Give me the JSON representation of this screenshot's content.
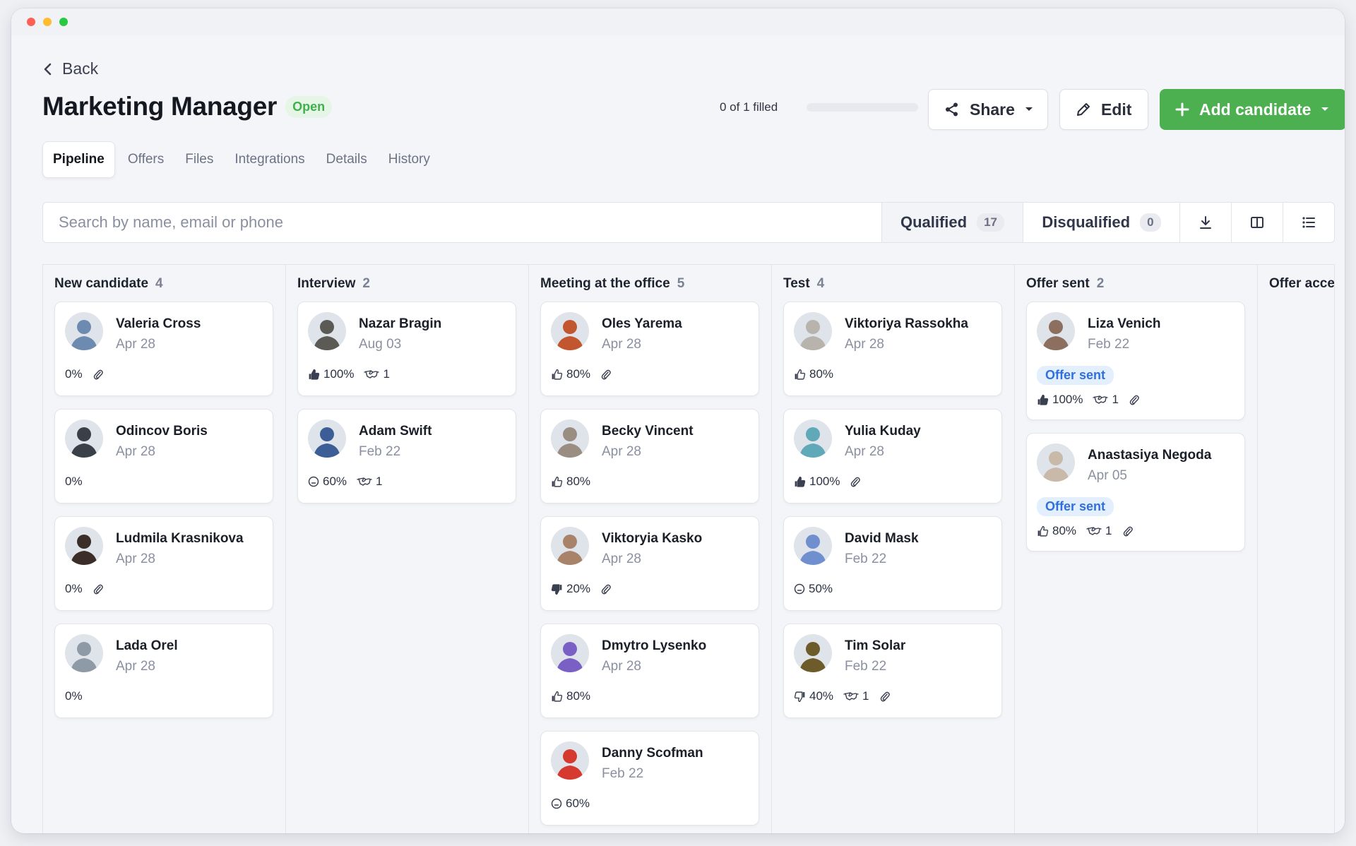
{
  "window": {
    "dot_colors": [
      "#ff5f57",
      "#febc2e",
      "#28c840"
    ]
  },
  "header": {
    "back_label": "Back",
    "title": "Marketing Manager",
    "status_badge": "Open",
    "filled_text": "0 of 1 filled",
    "filled_progress": 0,
    "share_label": "Share",
    "edit_label": "Edit",
    "add_label": "Add candidate"
  },
  "tabs": [
    {
      "label": "Pipeline",
      "active": true
    },
    {
      "label": "Offers"
    },
    {
      "label": "Files"
    },
    {
      "label": "Integrations"
    },
    {
      "label": "Details"
    },
    {
      "label": "History"
    }
  ],
  "filter": {
    "search_placeholder": "Search by name, email or phone",
    "qualified_label": "Qualified",
    "qualified_count": "17",
    "disqualified_label": "Disqualified",
    "disqualified_count": "0",
    "icons": [
      "download-icon",
      "columns-view-icon",
      "list-view-icon"
    ]
  },
  "columns": [
    {
      "title": "New candidate",
      "count": "4",
      "cards": [
        {
          "name": "Valeria Cross",
          "date": "Apr 28",
          "avatar_color": "#6d8bb0",
          "rating": {
            "type": "none",
            "value": "0%"
          },
          "attachment": true
        },
        {
          "name": "Odincov Boris",
          "date": "Apr 28",
          "avatar_color": "#3a3f48",
          "rating": {
            "type": "none",
            "value": "0%"
          }
        },
        {
          "name": "Ludmila Krasnikova",
          "date": "Apr 28",
          "avatar_color": "#3b2e28",
          "rating": {
            "type": "none",
            "value": "0%"
          },
          "attachment": true
        },
        {
          "name": "Lada Orel",
          "date": "Apr 28",
          "avatar_color": "#8e9aa6",
          "rating": {
            "type": "none",
            "value": "0%"
          }
        }
      ]
    },
    {
      "title": "Interview",
      "count": "2",
      "cards": [
        {
          "name": "Nazar Bragin",
          "date": "Aug 03",
          "avatar_color": "#5c5a55",
          "rating": {
            "type": "thumbs-up-filled",
            "value": "100%"
          },
          "interviews": "1"
        },
        {
          "name": "Adam Swift",
          "date": "Feb 22",
          "avatar_color": "#3c5d96",
          "rating": {
            "type": "neutral",
            "value": "60%"
          },
          "interviews": "1"
        }
      ]
    },
    {
      "title": "Meeting at the office",
      "count": "5",
      "cards": [
        {
          "name": "Oles Yarema",
          "date": "Apr 28",
          "avatar_color": "#c2562e",
          "rating": {
            "type": "thumbs-up",
            "value": "80%"
          },
          "attachment": true
        },
        {
          "name": "Becky Vincent",
          "date": "Apr 28",
          "avatar_color": "#9a8d82",
          "rating": {
            "type": "thumbs-up",
            "value": "80%"
          }
        },
        {
          "name": "Viktoryia Kasko",
          "date": "Apr 28",
          "avatar_color": "#a9826a",
          "rating": {
            "type": "thumbs-down-filled",
            "value": "20%"
          },
          "attachment": true
        },
        {
          "name": "Dmytro Lysenko",
          "date": "Apr 28",
          "avatar_color": "#7a5fc4",
          "rating": {
            "type": "thumbs-up",
            "value": "80%"
          }
        },
        {
          "name": "Danny Scofman",
          "date": "Feb 22",
          "avatar_color": "#d63a2f",
          "rating": {
            "type": "neutral",
            "value": "60%"
          }
        }
      ]
    },
    {
      "title": "Test",
      "count": "4",
      "cards": [
        {
          "name": "Viktoriya Rassokha",
          "date": "Apr 28",
          "avatar_color": "#b9b3ad",
          "rating": {
            "type": "thumbs-up",
            "value": "80%"
          }
        },
        {
          "name": "Yulia Kuday",
          "date": "Apr 28",
          "avatar_color": "#5fa9b8",
          "rating": {
            "type": "thumbs-up-filled",
            "value": "100%"
          },
          "attachment": true
        },
        {
          "name": "David Mask",
          "date": "Feb 22",
          "avatar_color": "#6f8fcf",
          "rating": {
            "type": "neutral",
            "value": "50%"
          }
        },
        {
          "name": "Tim Solar",
          "date": "Feb 22",
          "avatar_color": "#6e5b2a",
          "rating": {
            "type": "thumbs-down",
            "value": "40%"
          },
          "interviews": "1",
          "attachment": true
        }
      ]
    },
    {
      "title": "Offer sent",
      "count": "2",
      "cards": [
        {
          "name": "Liza Venich",
          "date": "Feb 22",
          "avatar_color": "#8c6f5e",
          "badge": "Offer sent",
          "rating": {
            "type": "thumbs-up-filled",
            "value": "100%"
          },
          "interviews": "1",
          "attachment": true
        },
        {
          "name": "Anastasiya Negoda",
          "date": "Apr 05",
          "avatar_color": "#c9b9a8",
          "badge": "Offer sent",
          "rating": {
            "type": "thumbs-up",
            "value": "80%"
          },
          "interviews": "1",
          "attachment": true
        }
      ]
    },
    {
      "title": "Offer acce",
      "count": "",
      "cards": []
    }
  ]
}
